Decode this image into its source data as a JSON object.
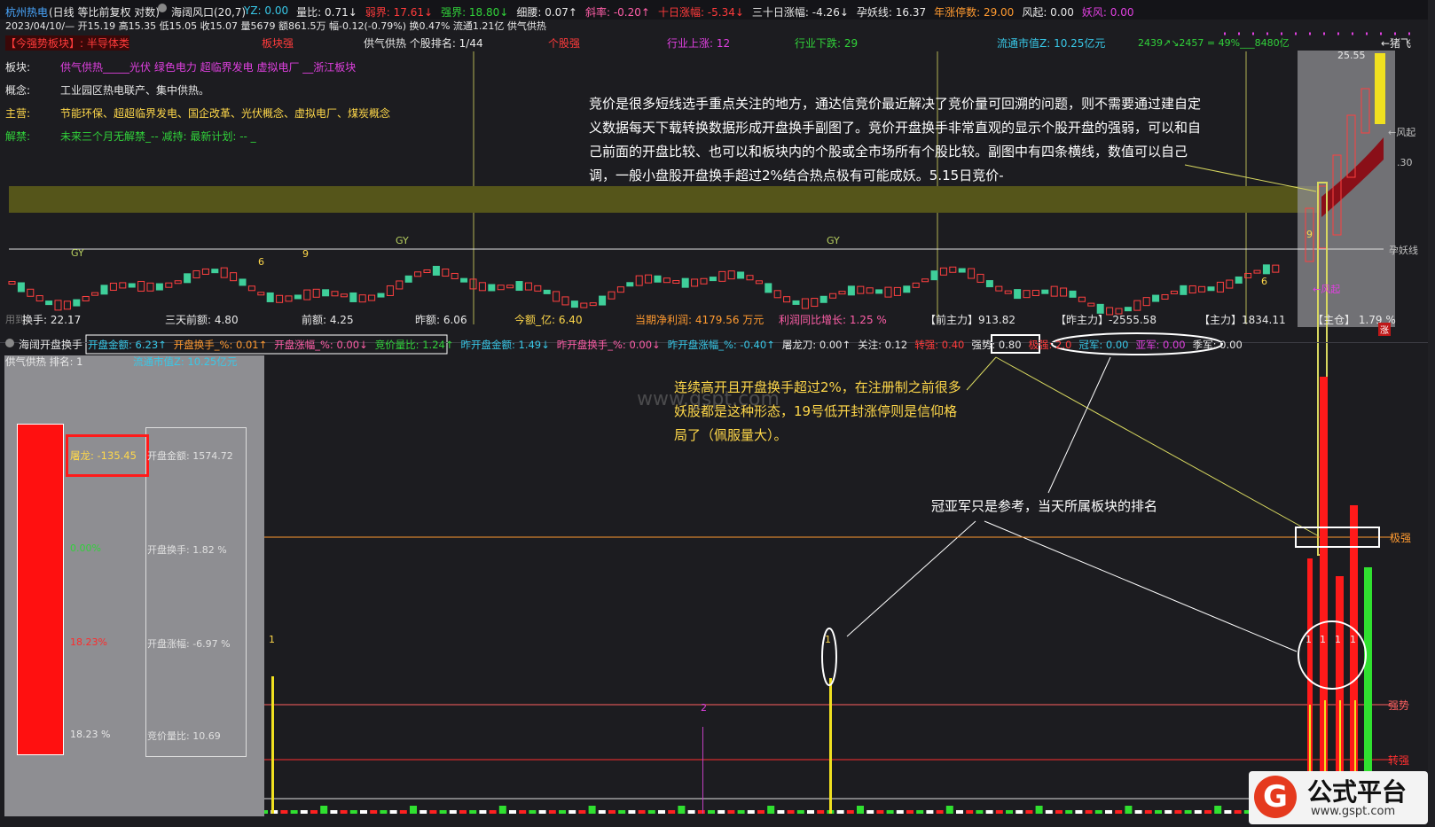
{
  "header": {
    "stock": "杭州热电",
    "mode": "(日线 等比前复权 对数)",
    "indicator": "海阔风口(20,7)",
    "items": [
      {
        "t": "YZ: 0.00",
        "c": "cy"
      },
      {
        "t": "量比: 0.71↓",
        "c": "wh"
      },
      {
        "t": "弱界: 17.61↓",
        "c": "rd"
      },
      {
        "t": "强界: 18.80↓",
        "c": "gr"
      },
      {
        "t": "细腰: 0.07↑",
        "c": "wh"
      },
      {
        "t": "斜率: -0.20↑",
        "c": "pk"
      },
      {
        "t": "十日涨幅: -5.34↓",
        "c": "rd"
      },
      {
        "t": "三十日涨幅: -4.26↓",
        "c": "wh"
      },
      {
        "t": "孕妖线: 16.37",
        "c": "wh"
      },
      {
        "t": "年涨停数: 29.00",
        "c": "or"
      },
      {
        "t": "风起: 0.00",
        "c": "wh"
      },
      {
        "t": "妖风: 0.00",
        "c": "mg"
      }
    ],
    "line2": "2023/04/10/— 开15.19 高15.35 低15.05 收15.07 量5679 额861.5万 幅-0.12(-0.79%) 换0.47% 流通1.21亿 供气供热"
  },
  "row2": [
    {
      "t": "【今强势板块】: 半导体类",
      "c": "rd"
    },
    {
      "t": "板块强",
      "c": "rd"
    },
    {
      "t": "供气供热 个股排名: 1/44",
      "c": "wh"
    },
    {
      "t": "个股强",
      "c": "rd"
    },
    {
      "t": "行业上涨: 12",
      "c": "mg"
    },
    {
      "t": "行业下跌: 29",
      "c": "gr"
    },
    {
      "t": "流通市值Z: 10.25亿元",
      "c": "cy"
    },
    {
      "t": "2439↗↘2457 = 49%___8480亿",
      "c": "gr"
    }
  ],
  "info_rows": [
    {
      "label": "板块:",
      "value": "供气供热_____光伏 绿色电力 超临界发电 虚拟电厂 __浙江板块",
      "c": "mg"
    },
    {
      "label": "概念:",
      "value": "工业园区热电联产、集中供热。",
      "c": "wh"
    },
    {
      "label": "主营:",
      "value": "节能环保、超超临界发电、国企改革、光伏概念、虚拟电厂、煤炭概念",
      "c": "yl"
    },
    {
      "label": "解禁:",
      "value": "未来三个月无解禁_--       减持:    最新计划: -- _",
      "c": "gr"
    }
  ],
  "main_labels": {
    "zhu_fei": "←猪飞",
    "price_top": "25.55",
    "fengqi": "←风起",
    "price_mid": ".30",
    "yunyaoxian": "孕妖线",
    "fengqi2": "←风起",
    "gy1": "GY",
    "gy2": "GY",
    "gy3": "GY",
    "n9": "9",
    "n6": "6",
    "n6b": "6",
    "n9b": "9"
  },
  "bottom_row": [
    {
      "t": "换手: 22.17",
      "c": "wh"
    },
    {
      "t": "三天前额: 4.80",
      "c": "wh"
    },
    {
      "t": "前额: 4.25",
      "c": "wh"
    },
    {
      "t": "昨额: 6.06",
      "c": "wh"
    },
    {
      "t": "今额_亿: 6.40",
      "c": "yl"
    },
    {
      "t": "当期净利润: 4179.56 万元",
      "c": "or"
    },
    {
      "t": "利润同比增长: 1.25 %",
      "c": "pk"
    },
    {
      "t": "【前主力】913.82",
      "c": "wh"
    },
    {
      "t": "【昨主力】-2555.58",
      "c": "wh"
    },
    {
      "t": "【主力】1834.11",
      "c": "wh"
    },
    {
      "t": "【主仓】 1.79 %",
      "c": "wh"
    }
  ],
  "sub_header": {
    "name": "海阔开盘换手",
    "items": [
      {
        "t": "开盘金额: 6.23↑",
        "c": "cy"
      },
      {
        "t": "开盘换手_%: 0.01↑",
        "c": "or"
      },
      {
        "t": "开盘涨幅_%: 0.00↓",
        "c": "pk"
      },
      {
        "t": "竞价量比: 1.24↑",
        "c": "gr"
      },
      {
        "t": "昨开盘金额: 1.49↓",
        "c": "cy"
      },
      {
        "t": "昨开盘换手_%: 0.00↓",
        "c": "pk"
      },
      {
        "t": "昨开盘涨幅_%: -0.40↑",
        "c": "cy"
      },
      {
        "t": "屠龙刀: 0.00↑",
        "c": "wh"
      },
      {
        "t": "关注: 0.12",
        "c": "wh"
      },
      {
        "t": "转强: 0.40",
        "c": "rd"
      },
      {
        "t": "强势: 0.80",
        "c": "wh"
      },
      {
        "t": "极强: 2.0",
        "c": "rd"
      },
      {
        "t": "冠军: 0.00",
        "c": "cy"
      },
      {
        "t": "亚军: 0.00",
        "c": "mg"
      },
      {
        "t": "季军: 0.00",
        "c": "wh"
      }
    ],
    "line2_a": "供气供热  排名: 1",
    "line2_b": "流通市值Z: 10.25亿元"
  },
  "panel": {
    "tulong": "屠龙: -135.45",
    "pct_green": "0.00%",
    "pct_red": "18.23%",
    "vol_pct": "18.23 %",
    "open_amt": "开盘金额: 1574.72",
    "open_turn": "开盘换手: 1.82 %",
    "open_rise": "开盘涨幅: -6.97 %",
    "auction_ratio": "竞价量比: 10.69"
  },
  "right_labels": {
    "jiqiang": "极强",
    "qiangshi": "强势",
    "zhuanqiang": "转强"
  },
  "bar_marks": {
    "m1": "1",
    "m2": "2",
    "m3": "1",
    "m4": "1",
    "m5": "1",
    "m6": "1",
    "m7": "1"
  },
  "annotations": {
    "a1": "竞价是很多短线选手重点关注的地方，通达信竞价最近解决了竞价量可回溯的问题，则不需要通过建自定义数据每天下载转换数据形成开盘换手副图了。竞价开盘换手非常直观的显示个股开盘的强弱，可以和自己前面的开盘比较、也可以和板块内的个股或全市场所有个股比较。副图中有四条横线，数值可以自己调，一般小盘股开盘换手超过2%结合热点极有可能成妖。5.15日竞价-",
    "a2": "连续高开且开盘换手超过2%，在注册制之前很多妖股都是这种形态，19号低开封涨停则是信仰格局了（佩服量大）。",
    "a3": "冠亚军只是参考，当天所属板块的排名"
  },
  "watermark": "www.gspt.com",
  "logo": {
    "g": "G",
    "text": "公式平台",
    "url": "www.gspt.com"
  },
  "misc": {
    "zhang": "涨",
    "yongdao": "用到"
  }
}
